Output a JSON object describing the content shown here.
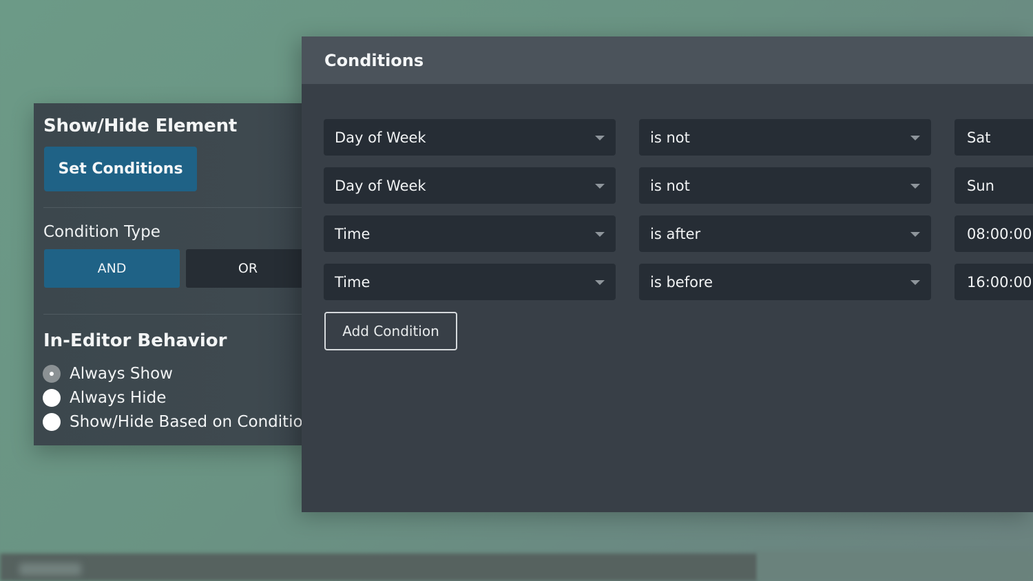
{
  "left_panel": {
    "title": "Show/Hide Element",
    "set_conditions_label": "Set Conditions",
    "condition_type_label": "Condition Type",
    "condition_types": [
      {
        "label": "AND",
        "selected": true
      },
      {
        "label": "OR",
        "selected": false
      }
    ],
    "editor_behavior_heading": "In-Editor Behavior",
    "editor_behavior_options": [
      {
        "label": "Always Show",
        "checked": true
      },
      {
        "label": "Always Hide",
        "checked": false
      },
      {
        "label": "Show/Hide Based on Condition",
        "checked": false
      }
    ]
  },
  "modal": {
    "title": "Conditions",
    "conditions": [
      {
        "field": "Day of Week",
        "operator": "is not",
        "value": "Sat"
      },
      {
        "field": "Day of Week",
        "operator": "is not",
        "value": "Sun"
      },
      {
        "field": "Time",
        "operator": "is after",
        "value": "08:00:00"
      },
      {
        "field": "Time",
        "operator": "is before",
        "value": "16:00:00"
      }
    ],
    "add_condition_label": "Add Condition"
  },
  "colors": {
    "primary": "#1f6286",
    "panel_bg": "#3e494f",
    "modal_bg": "#383f47",
    "modal_header_bg": "#4b535b",
    "select_bg": "#262d35",
    "background": "#6c9a87"
  }
}
